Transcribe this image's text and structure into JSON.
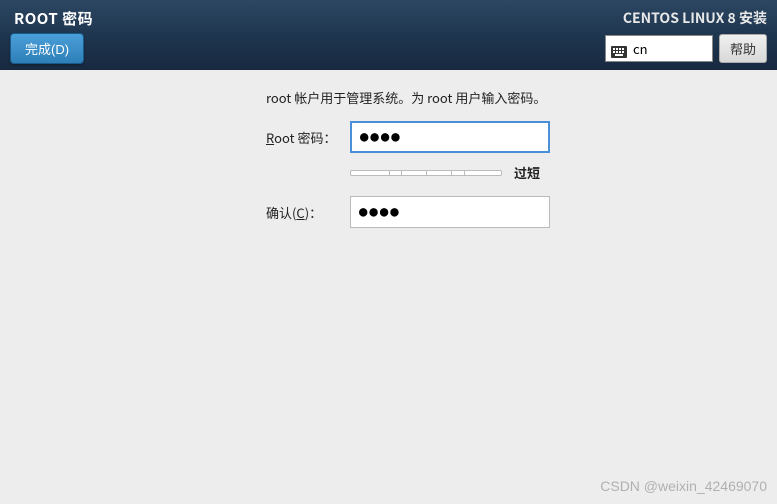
{
  "header": {
    "title": "ROOT 密码",
    "done_label": "完成(D)",
    "distro": "CENTOS LINUX 8 安装",
    "keyboard_layout": "cn",
    "help_label": "帮助"
  },
  "form": {
    "instruction": "root 帐户用于管理系统。为 root 用户输入密码。",
    "password_label_pre": "R",
    "password_label_post": "oot 密码：",
    "password_value": "●●●●",
    "confirm_label_pre": "确认(",
    "confirm_label_underline": "C",
    "confirm_label_post": ")：",
    "confirm_value": "●●●●",
    "strength_label": "过短"
  },
  "watermark": "CSDN @weixin_42469070"
}
